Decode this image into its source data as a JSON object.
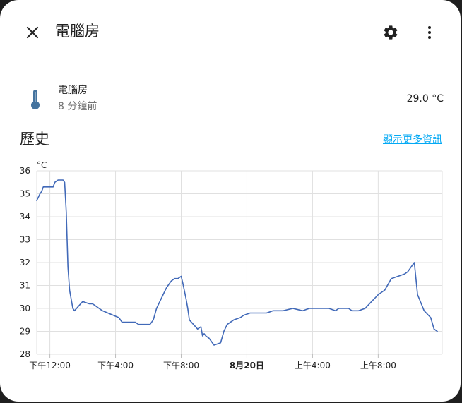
{
  "header": {
    "title": "電腦房"
  },
  "entity": {
    "name": "電腦房",
    "last_changed": "8 分鐘前",
    "value": "29.0 °C"
  },
  "history": {
    "title": "歷史",
    "more_info_label": "顯示更多資訊"
  },
  "colors": {
    "accent": "#03a9f4",
    "line": "#4169b8",
    "icon": "#44739e"
  },
  "chart_data": {
    "type": "line",
    "ylabel": "°C",
    "ylim": [
      28,
      36
    ],
    "y_ticks": [
      "28",
      "29",
      "30",
      "31",
      "32",
      "33",
      "34",
      "35",
      "36"
    ],
    "x_range_hours": [
      11.2,
      35.9
    ],
    "x_ticks": [
      {
        "hour": 12,
        "label": "下午12:00",
        "bold": false
      },
      {
        "hour": 16,
        "label": "下午4:00",
        "bold": false
      },
      {
        "hour": 20,
        "label": "下午8:00",
        "bold": false
      },
      {
        "hour": 24,
        "label": "8月20日",
        "bold": true
      },
      {
        "hour": 28,
        "label": "上午4:00",
        "bold": false
      },
      {
        "hour": 32,
        "label": "上午8:00",
        "bold": false
      }
    ],
    "grid": true,
    "series": [
      {
        "x": [
          11.2,
          11.4,
          11.5,
          11.6,
          12.2,
          12.3,
          12.5,
          12.8,
          12.9,
          13.0,
          13.05,
          13.1,
          13.2,
          13.3,
          13.4,
          13.5,
          14.0,
          14.4,
          14.6,
          14.8,
          15.0,
          15.2,
          16.2,
          16.4,
          17.2,
          17.4,
          17.6,
          17.9,
          18.1,
          18.3,
          18.5,
          18.9,
          19.1,
          19.2,
          19.3,
          19.4,
          19.6,
          19.8,
          20.0,
          20.1,
          20.3,
          20.4,
          20.5,
          21.0,
          21.2,
          21.3,
          21.4,
          21.5,
          21.7,
          22.0,
          22.4,
          22.6,
          22.8,
          23.2,
          23.6,
          23.8,
          24.2,
          24.8,
          25.2,
          25.6,
          25.8,
          26.0,
          26.2,
          26.8,
          27.4,
          27.8,
          28.0,
          28.2,
          28.6,
          28.8,
          29.0,
          29.4,
          29.6,
          29.8,
          30.0,
          30.2,
          30.4,
          30.6,
          30.8,
          31.2,
          31.6,
          32.0,
          32.4,
          32.8,
          33.2,
          33.6,
          33.8,
          33.9,
          34.0,
          34.2,
          34.4,
          34.8,
          35.2,
          35.4,
          35.6
        ],
        "y": [
          34.7,
          35.0,
          35.1,
          35.3,
          35.3,
          35.5,
          35.6,
          35.6,
          35.5,
          34.2,
          33.0,
          31.8,
          30.8,
          30.4,
          30.0,
          29.9,
          30.3,
          30.2,
          30.2,
          30.1,
          30.0,
          29.9,
          29.6,
          29.4,
          29.4,
          29.3,
          29.3,
          29.3,
          29.3,
          29.5,
          30.0,
          30.6,
          30.9,
          31.0,
          31.1,
          31.2,
          31.3,
          31.3,
          31.4,
          31.1,
          30.4,
          30.0,
          29.5,
          29.1,
          29.2,
          28.8,
          28.9,
          28.8,
          28.7,
          28.4,
          28.5,
          29.0,
          29.3,
          29.5,
          29.6,
          29.7,
          29.8,
          29.8,
          29.8,
          29.9,
          29.9,
          29.9,
          29.9,
          30.0,
          29.9,
          30.0,
          30.0,
          30.0,
          30.0,
          30.0,
          30.0,
          29.9,
          30.0,
          30.0,
          30.0,
          30.0,
          29.9,
          29.9,
          29.9,
          30.0,
          30.3,
          30.6,
          30.8,
          31.3,
          31.4,
          31.5,
          31.6,
          31.7,
          31.8,
          32.0,
          30.6,
          29.9,
          29.6,
          29.1,
          29.0
        ]
      }
    ]
  }
}
